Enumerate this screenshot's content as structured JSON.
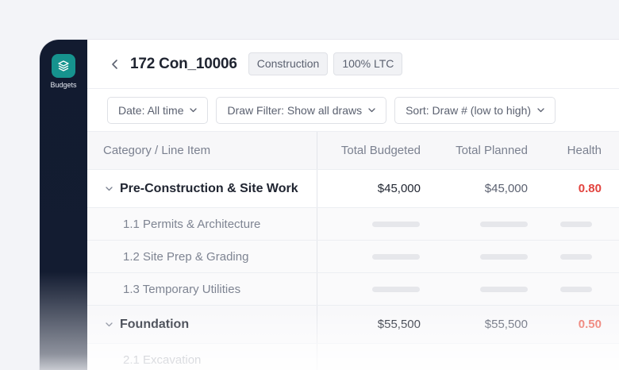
{
  "sidebar": {
    "items": [
      {
        "label": "Budgets",
        "icon": "layers-icon",
        "active": true
      }
    ],
    "accent": "#16938e",
    "background": "#121b30"
  },
  "header": {
    "title": "172 Con_10006",
    "tags": [
      "Construction",
      "100% LTC"
    ]
  },
  "filters": {
    "date": "Date: All time",
    "draw": "Draw Filter: Show all draws",
    "sort": "Sort: Draw # (low to high)"
  },
  "table": {
    "columns": [
      "Category / Line Item",
      "Total Budgeted",
      "Total Planned",
      "Health"
    ],
    "rows": [
      {
        "category": "Pre-Construction & Site Work",
        "total_budgeted": "$45,000",
        "total_planned": "$45,000",
        "health": "0.80",
        "items": [
          "1.1 Permits & Architecture",
          "1.2 Site Prep & Grading",
          "1.3 Temporary Utilities"
        ]
      },
      {
        "category": "Foundation",
        "total_budgeted": "$55,500",
        "total_planned": "$55,500",
        "health": "0.50",
        "items": [
          "2.1 Excavation"
        ]
      }
    ]
  },
  "colors": {
    "health_red": "#e2433e",
    "health_light_red": "#ec6e62",
    "text_primary": "#1f2430",
    "text_muted": "#7e8492"
  }
}
